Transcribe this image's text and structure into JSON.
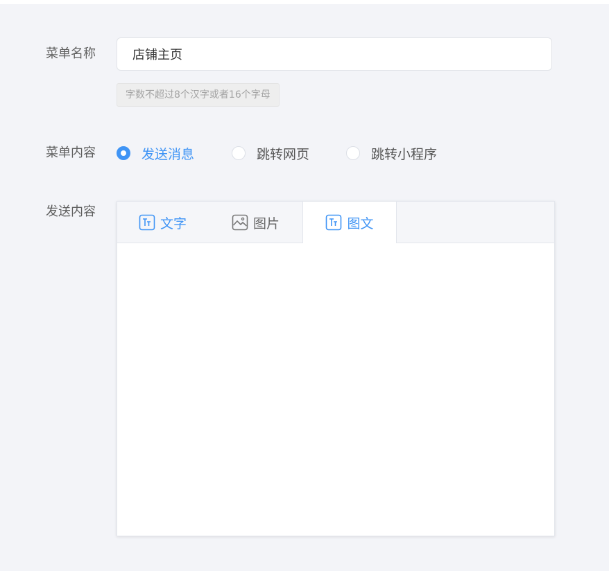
{
  "form": {
    "menu_name_label": "菜单名称",
    "menu_name_value": "店铺主页",
    "menu_name_hint": "字数不超过8个汉字或者16个字母",
    "menu_content_label": "菜单内容",
    "menu_content_options": [
      {
        "label": "发送消息",
        "selected": true
      },
      {
        "label": "跳转网页",
        "selected": false
      },
      {
        "label": "跳转小程序",
        "selected": false
      }
    ],
    "send_content_label": "发送内容",
    "tabs": [
      {
        "label": "文字",
        "icon": "text-icon",
        "active": false
      },
      {
        "label": "图片",
        "icon": "image-icon",
        "active": false
      },
      {
        "label": "图文",
        "icon": "text-image-icon",
        "active": true
      }
    ]
  },
  "colors": {
    "accent": "#3f94f5",
    "background": "#f3f4f8",
    "label": "#5f5f5f",
    "hint_text": "#a3a3a3"
  }
}
